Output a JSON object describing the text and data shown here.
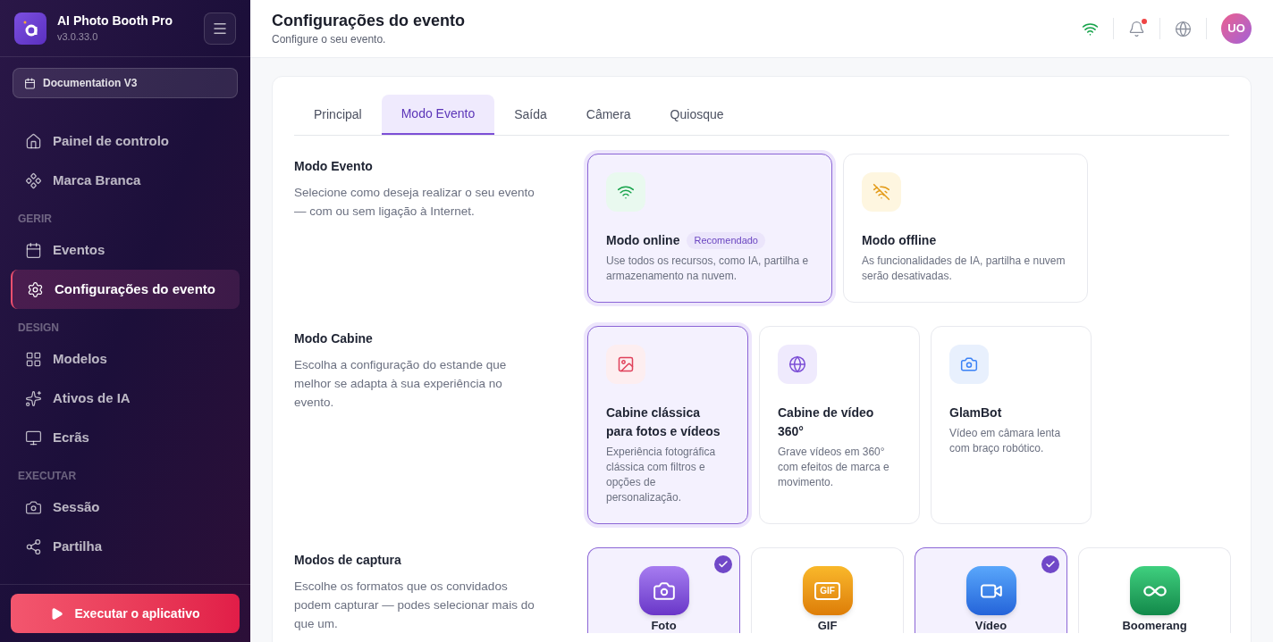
{
  "app": {
    "name": "AI Photo Booth Pro",
    "version": "v3.0.33.0"
  },
  "event_selector": {
    "label": "Documentation V3"
  },
  "nav": [
    {
      "kind": "item",
      "label": "Painel de controlo",
      "selected": false
    },
    {
      "kind": "item",
      "label": "Marca Branca",
      "selected": false
    },
    {
      "kind": "heading",
      "label": "GERIR"
    },
    {
      "kind": "item",
      "label": "Eventos",
      "selected": false
    },
    {
      "kind": "item",
      "label": "Configurações do evento",
      "selected": true
    },
    {
      "kind": "heading",
      "label": "DESIGN"
    },
    {
      "kind": "item",
      "label": "Modelos",
      "selected": false
    },
    {
      "kind": "item",
      "label": "Ativos de IA",
      "selected": false
    },
    {
      "kind": "item",
      "label": "Ecrãs",
      "selected": false
    },
    {
      "kind": "heading",
      "label": "EXECUTAR"
    },
    {
      "kind": "item",
      "label": "Sessão",
      "selected": false
    },
    {
      "kind": "item",
      "label": "Partilha",
      "selected": false
    }
  ],
  "run_button": {
    "label": "Executar o aplicativo"
  },
  "header": {
    "title": "Configurações do evento",
    "subtitle": "Configure o seu evento.",
    "notification": true,
    "avatar": "UO"
  },
  "tabs": [
    {
      "label": "Principal",
      "selected": false
    },
    {
      "label": "Modo Evento",
      "selected": true
    },
    {
      "label": "Saída",
      "selected": false
    },
    {
      "label": "Câmera",
      "selected": false
    },
    {
      "label": "Quiosque",
      "selected": false
    }
  ],
  "sections": [
    {
      "kind": "choice",
      "title": "Modo Evento",
      "description": "Selecione como deseja realizar o seu evento — com ou sem ligação à Internet.",
      "options": [
        {
          "title": "Modo online",
          "badge": "Recomendado",
          "description": "Use todos os recursos, como IA, partilha e armazenamento na nuvem.",
          "selected": true
        },
        {
          "title": "Modo offline",
          "description": "As funcionalidades de IA, partilha e nuvem serão desativadas.",
          "selected": false
        }
      ]
    },
    {
      "kind": "choice",
      "title": "Modo Cabine",
      "description": "Escolha a configuração do estande que melhor se adapta à sua experiência no evento.",
      "options": [
        {
          "title": "Cabine clássica para fotos e vídeos",
          "description": "Experiência fotográfica clássica com filtros e opções de personalização.",
          "selected": true
        },
        {
          "title": "Cabine de vídeo 360°",
          "description": "Grave vídeos em 360° com efeitos de marca e movimento.",
          "selected": false
        },
        {
          "title": "GlamBot",
          "description": "Vídeo em câmara lenta com braço robótico.",
          "selected": false
        }
      ]
    },
    {
      "kind": "capture",
      "title": "Modos de captura",
      "description": "Escolhe os formatos que os convidados podem capturar — podes selecionar mais do que um.",
      "options": [
        {
          "label": "Foto",
          "checked": true
        },
        {
          "label": "GIF",
          "icon_text": "GIF",
          "checked": false
        },
        {
          "label": "Vídeo",
          "checked": true
        },
        {
          "label": "Boomerang",
          "checked": false
        }
      ]
    }
  ]
}
